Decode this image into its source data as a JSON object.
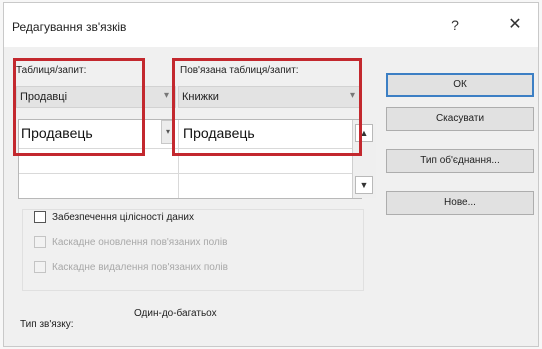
{
  "dialog": {
    "title": "Редагування зв'язків",
    "help_symbol": "?",
    "close_symbol": "✕"
  },
  "columns": {
    "left_label": "Таблиця/запит:",
    "right_label": "Пов'язана таблиця/запит:",
    "left_table": "Продавці",
    "right_table": "Книжки",
    "left_field": "Продавець",
    "right_field": "Продавець"
  },
  "buttons": {
    "ok": "ОК",
    "cancel": "Скасувати",
    "join_type": "Тип об'єднання...",
    "new": "Нове..."
  },
  "options": {
    "enforce_integrity": "Забезпечення цілісності даних",
    "cascade_update": "Каскадне оновлення пов'язаних полів",
    "cascade_delete": "Каскадне видалення пов'язаних полів"
  },
  "relationship": {
    "label": "Тип зв'язку:",
    "value": "Один-до-багатьох"
  },
  "icons": {
    "dropdown": "▾",
    "scroll_up": "▲",
    "scroll_down": "▼"
  },
  "colors": {
    "highlight": "#c3282e",
    "ok_border": "#3c7fc4"
  }
}
